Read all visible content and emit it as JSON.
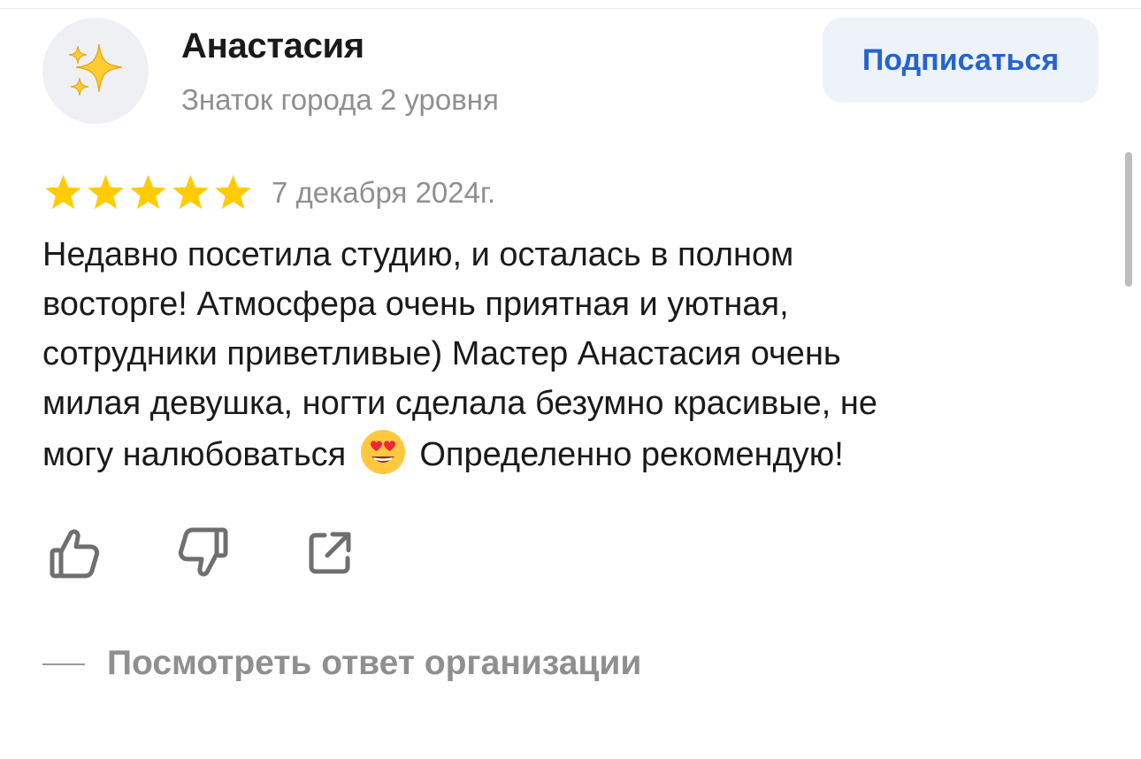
{
  "review": {
    "author": {
      "name": "Анастасия",
      "level": "Знаток города 2 уровня",
      "avatar_icon": "sparkles-icon"
    },
    "subscribe_label": "Подписаться",
    "rating": 5,
    "rating_max": 5,
    "date": "7 декабря 2024г.",
    "text_lines": [
      "Недавно посетила студию, и осталась в полном",
      "восторге! Атмосфера очень приятная и уютная,",
      "сотрудники приветливые) Мастер Анастасия очень",
      "милая девушка, ногти сделала безумно красивые, не"
    ],
    "text_last_before_emoji": "могу налюбоваться",
    "emoji_icon": "heart-eyes-emoji-icon",
    "text_last_after_emoji": "Определенно рекомендую!",
    "actions": {
      "like_icon": "thumbs-up-icon",
      "dislike_icon": "thumbs-down-icon",
      "share_icon": "share-external-icon"
    },
    "reply_link_label": "Посмотреть ответ организации"
  },
  "colors": {
    "star": "#FFCC00",
    "accent": "#2463D1",
    "button_bg": "#EEF3FA",
    "muted_text": "#8F8F8F",
    "icon_gray": "#6F6F6F"
  }
}
